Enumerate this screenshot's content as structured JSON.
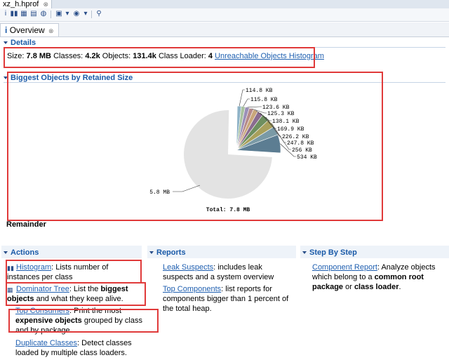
{
  "editor": {
    "tab_title": "xz_h.hprof",
    "close_symbol": "⊗"
  },
  "subtab": {
    "label": "Overview",
    "close_symbol": "⊗"
  },
  "details": {
    "title": "Details",
    "size_label": "Size:",
    "size_value": "7.8 MB",
    "classes_label": "Classes:",
    "classes_value": "4.2k",
    "objects_label": "Objects:",
    "objects_value": "131.4k",
    "loader_label": "Class Loader:",
    "loader_value": "4",
    "link": "Unreachable Objects Histogram"
  },
  "biggest": {
    "title": "Biggest Objects by Retained Size",
    "remainder_label": "Remainder"
  },
  "chart_data": {
    "type": "pie",
    "title": "",
    "total_label": "Total: 7.8 MB",
    "slices": [
      {
        "label": "114.8 KB",
        "value": 114.8,
        "color": "#8fb3c7"
      },
      {
        "label": "115.8 KB",
        "value": 115.8,
        "color": "#a9c2a0"
      },
      {
        "label": "123.6 KB",
        "value": 123.6,
        "color": "#9b8fb8"
      },
      {
        "label": "125.3 KB",
        "value": 125.3,
        "color": "#b58a8a"
      },
      {
        "label": "138.1 KB",
        "value": 138.1,
        "color": "#c9a77a"
      },
      {
        "label": "169.9 KB",
        "value": 169.9,
        "color": "#8a6c8f"
      },
      {
        "label": "226.2 KB",
        "value": 226.2,
        "color": "#6e8f5f"
      },
      {
        "label": "247.8 KB",
        "value": 247.8,
        "color": "#a8a05c"
      },
      {
        "label": "256 KB",
        "value": 256,
        "color": "#7a9aa6"
      },
      {
        "label": "534 KB",
        "value": 534,
        "color": "#5c7d92"
      },
      {
        "label": "5.8 MB",
        "value": 5939,
        "color": "#e3e3e3"
      }
    ]
  },
  "actions": {
    "title": "Actions",
    "histogram_link": "Histogram",
    "histogram_text": ": Lists number of instances per class",
    "dominator_link": "Dominator Tree",
    "dominator_text1": ": List the ",
    "dominator_bold": "biggest objects",
    "dominator_text2": " and what they keep alive.",
    "consumers_link": "Top Consumers",
    "consumers_text1": ": Print the most ",
    "consumers_bold": "expensive objects",
    "consumers_text2": " grouped by class and by package.",
    "duplicate_link": "Duplicate Classes",
    "duplicate_text": ": Detect classes loaded by multiple class loaders."
  },
  "reports": {
    "title": "Reports",
    "leak_link": "Leak Suspects",
    "leak_text": ": includes leak suspects and a system overview",
    "top_link": "Top Components",
    "top_text": ": list reports for components bigger than 1 percent of the total heap."
  },
  "steps": {
    "title": "Step By Step",
    "component_link": "Component Report",
    "component_text1": ": Analyze objects which belong to a ",
    "component_bold1": "common root package",
    "component_text2": " or ",
    "component_bold2": "class loader",
    "component_text3": "."
  },
  "colors": {
    "accent": "#1a5aa8",
    "link": "#1f5fb0",
    "annotation": "#e03a3a"
  }
}
